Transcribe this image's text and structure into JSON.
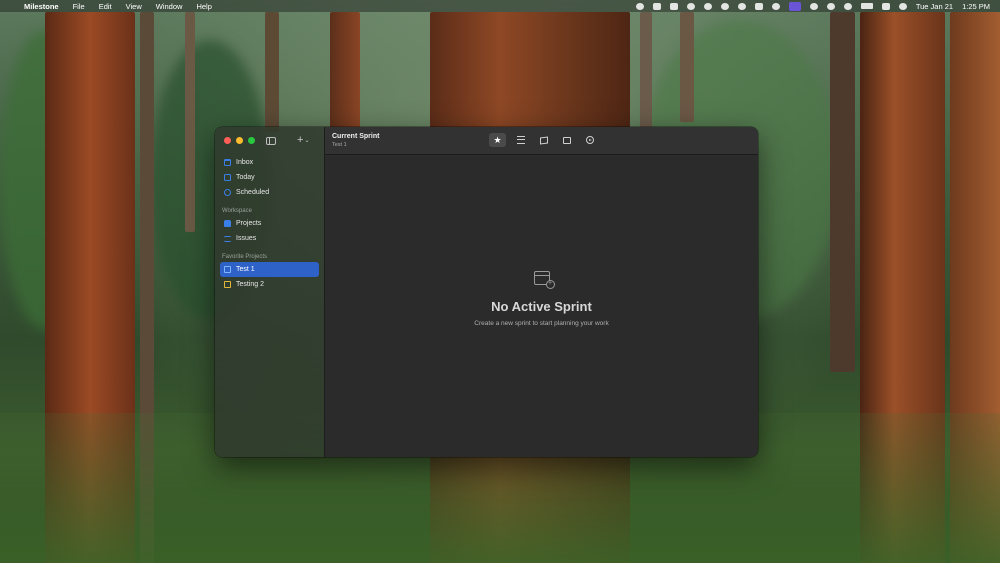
{
  "menubar": {
    "app_name": "Milestone",
    "menus": [
      "File",
      "Edit",
      "View",
      "Window",
      "Help"
    ],
    "date": "Tue Jan 21",
    "time": "1:25 PM"
  },
  "window": {
    "toolbar": {
      "title": "Current Sprint",
      "subtitle": "Test 1"
    },
    "sidebar": {
      "top_items": [
        {
          "label": "Inbox",
          "icon": "inbox-icon"
        },
        {
          "label": "Today",
          "icon": "calendar-icon"
        },
        {
          "label": "Scheduled",
          "icon": "clock-icon"
        }
      ],
      "workspace_label": "Workspace",
      "workspace_items": [
        {
          "label": "Projects",
          "icon": "projects-icon"
        },
        {
          "label": "Issues",
          "icon": "issues-icon"
        }
      ],
      "favorites_label": "Favorite Projects",
      "favorite_items": [
        {
          "label": "Test 1",
          "icon": "folder-icon",
          "selected": true
        },
        {
          "label": "Testing 2",
          "icon": "folder-icon",
          "selected": false
        }
      ]
    },
    "empty_state": {
      "title": "No Active Sprint",
      "subtitle": "Create a new sprint to start planning your work"
    }
  },
  "colors": {
    "accent": "#2f62c8",
    "close": "#ff5f57",
    "minimize": "#febc2e",
    "maximize": "#28c840"
  }
}
